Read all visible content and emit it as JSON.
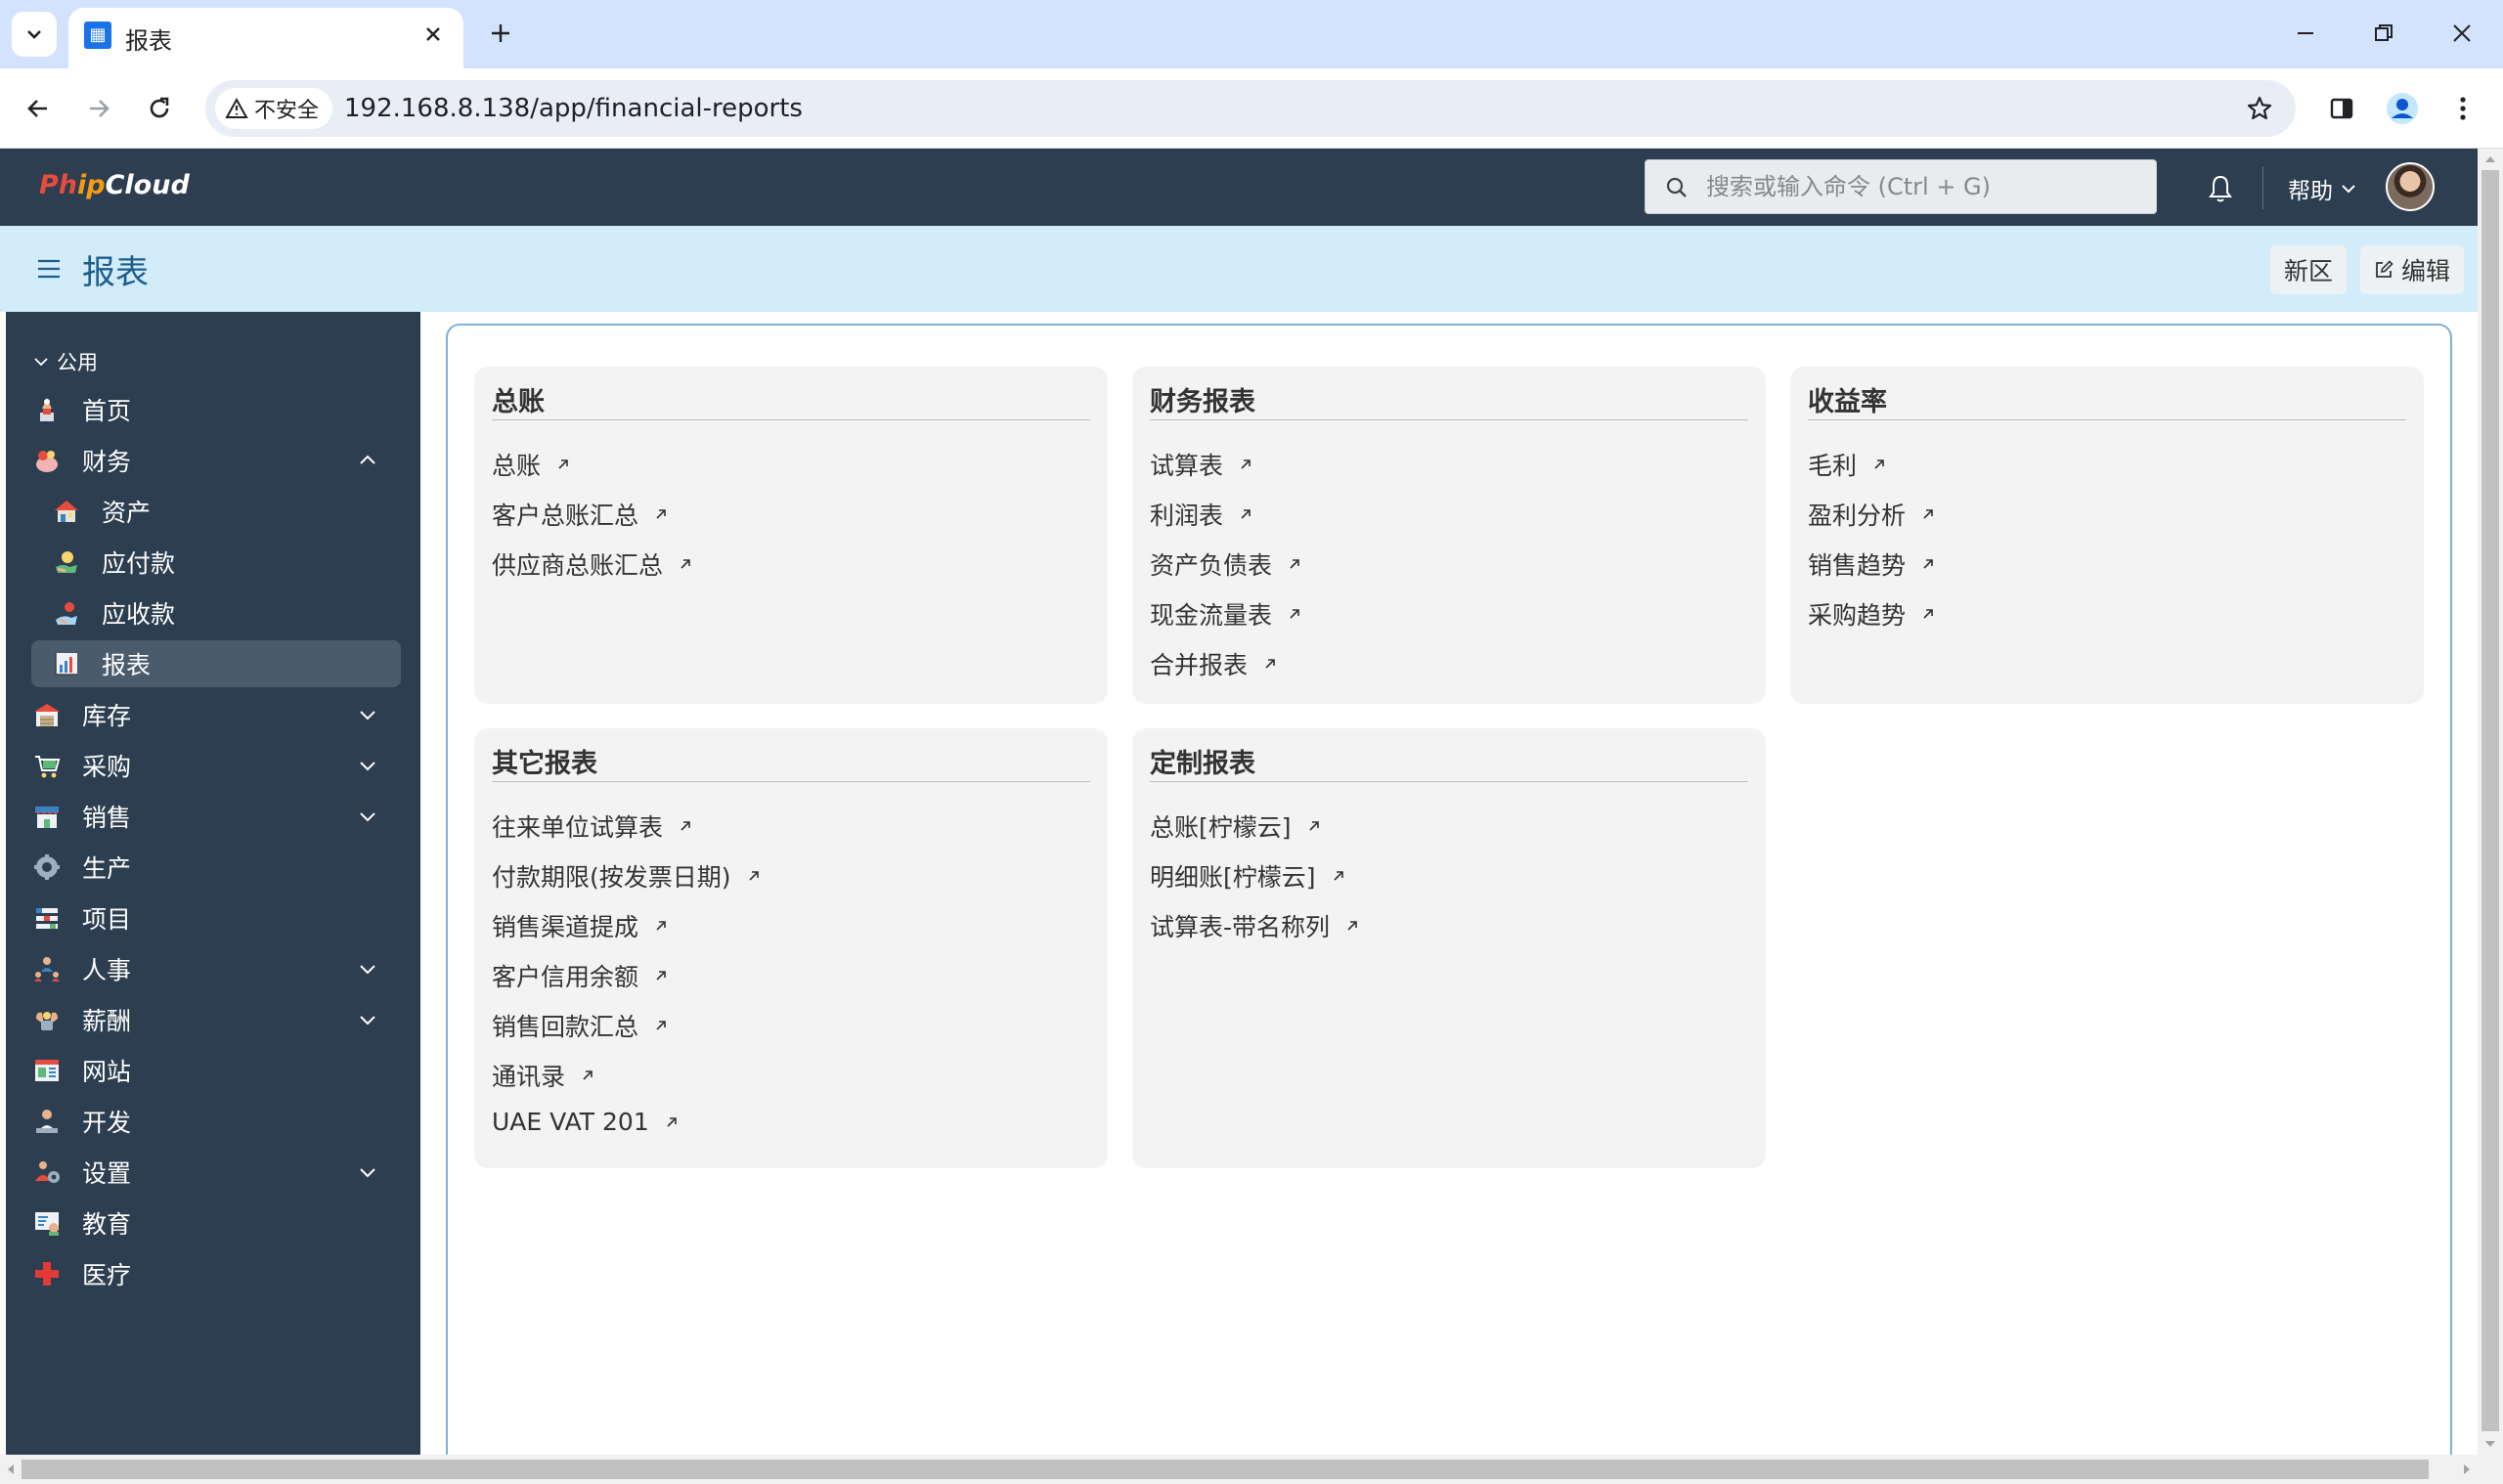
{
  "browser": {
    "tab_title": "报表",
    "security_label": "不安全",
    "url": "192.168.8.138/app/financial-reports"
  },
  "navbar": {
    "logo_parts": [
      "Ph",
      "ip",
      "Cloud"
    ],
    "search_placeholder": "搜索或输入命令 (Ctrl + G)",
    "help_label": "帮助"
  },
  "page": {
    "title": "报表",
    "new_area_label": "新区",
    "edit_label": "编辑"
  },
  "sidebar": {
    "group_label": "公用",
    "items": [
      {
        "label": "首页",
        "icon": "home-icon"
      },
      {
        "label": "财务",
        "icon": "finance-icon"
      },
      {
        "label": "资产",
        "icon": "asset-icon"
      },
      {
        "label": "应付款",
        "icon": "payable-icon"
      },
      {
        "label": "应收款",
        "icon": "receivable-icon"
      },
      {
        "label": "报表",
        "icon": "report-icon"
      },
      {
        "label": "库存",
        "icon": "stock-icon"
      },
      {
        "label": "采购",
        "icon": "purchase-icon"
      },
      {
        "label": "销售",
        "icon": "sales-icon"
      },
      {
        "label": "生产",
        "icon": "manufacturing-icon"
      },
      {
        "label": "项目",
        "icon": "project-icon"
      },
      {
        "label": "人事",
        "icon": "hr-icon"
      },
      {
        "label": "薪酬",
        "icon": "payroll-icon"
      },
      {
        "label": "网站",
        "icon": "website-icon"
      },
      {
        "label": "开发",
        "icon": "develop-icon"
      },
      {
        "label": "设置",
        "icon": "settings-icon"
      },
      {
        "label": "教育",
        "icon": "education-icon"
      },
      {
        "label": "医疗",
        "icon": "healthcare-icon"
      }
    ]
  },
  "cards": [
    {
      "title": "总账",
      "links": [
        "总账",
        "客户总账汇总",
        "供应商总账汇总"
      ]
    },
    {
      "title": "财务报表",
      "links": [
        "试算表",
        "利润表",
        "资产负债表",
        "现金流量表",
        "合并报表"
      ]
    },
    {
      "title": "收益率",
      "links": [
        "毛利",
        "盈利分析",
        "销售趋势",
        "采购趋势"
      ]
    },
    {
      "title": "其它报表",
      "links": [
        "往来单位试算表",
        "付款期限(按发票日期)",
        "销售渠道提成",
        "客户信用余额",
        "销售回款汇总",
        "通讯录",
        "UAE VAT 201"
      ]
    },
    {
      "title": "定制报表",
      "links": [
        "总账[柠檬云]",
        "明细账[柠檬云]",
        "试算表-带名称列"
      ]
    }
  ],
  "colors": {
    "navbar_bg": "#2c3e50",
    "page_header_bg": "#d2ecfa",
    "card_bg": "#f3f3f3",
    "active_item_bg": "#4a5b6c",
    "title_color": "#1d5d8c"
  }
}
